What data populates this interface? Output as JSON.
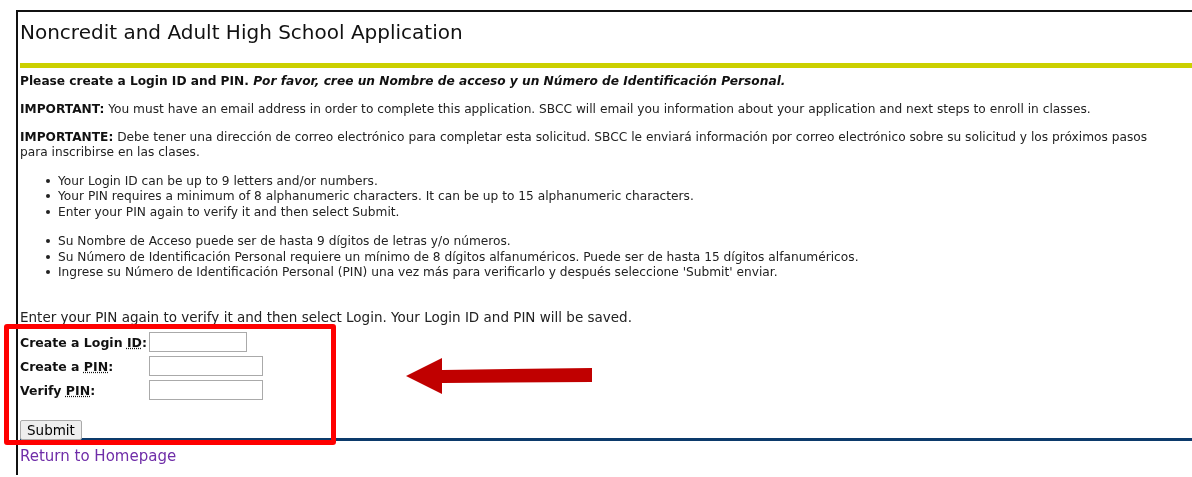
{
  "page": {
    "title": "Noncredit and Adult High School Application"
  },
  "intro": "Please create a Login ID and PIN. *Por favor, cree un Nombre de acceso y un Número de Identificación Personal.*",
  "notices": [
    "**IMPORTANT:** You must have an email address in order to complete this application. SBCC will email you information about your application and next steps to enroll in classes.",
    "**IMPORTANTE:** Debe tener una dirección de correo electrónico para completar esta solicitud. SBCC le enviará información por correo electrónico sobre su solicitud y los próximos pasos para inscribirse en las clases."
  ],
  "bullet_lists": [
    [
      "Your Login ID can be up to 9 letters and/or numbers.",
      "Your PIN requires a minimum of 8 alphanumeric characters. It can be up to 15 alphanumeric characters.",
      "Enter your PIN again to verify it and then select Submit."
    ],
    [
      "Su Nombre de Acceso puede ser de hasta 9 dígitos de letras y/o números.",
      "Su Número de Identificación Personal requiere un mínimo de 8 dígitos alfanuméricos. Puede ser de hasta 15 dígitos alfanuméricos.",
      "Ingrese su Número de Identificación Personal (PIN) una vez más para verificarlo y después seleccione 'Submit' enviar."
    ]
  ],
  "instruction": "Enter your PIN again to verify it and then select Login. Your Login ID and PIN will be saved.",
  "form": {
    "fields": [
      {
        "prefix": "Create a Login ",
        "abbr": "ID",
        "suffix": ":"
      },
      {
        "prefix": "Create a ",
        "abbr": "PIN",
        "suffix": ":"
      },
      {
        "prefix": "Verify ",
        "abbr": "PIN",
        "suffix": ":"
      }
    ],
    "submit": "Submit"
  },
  "link": "Return to Homepage"
}
